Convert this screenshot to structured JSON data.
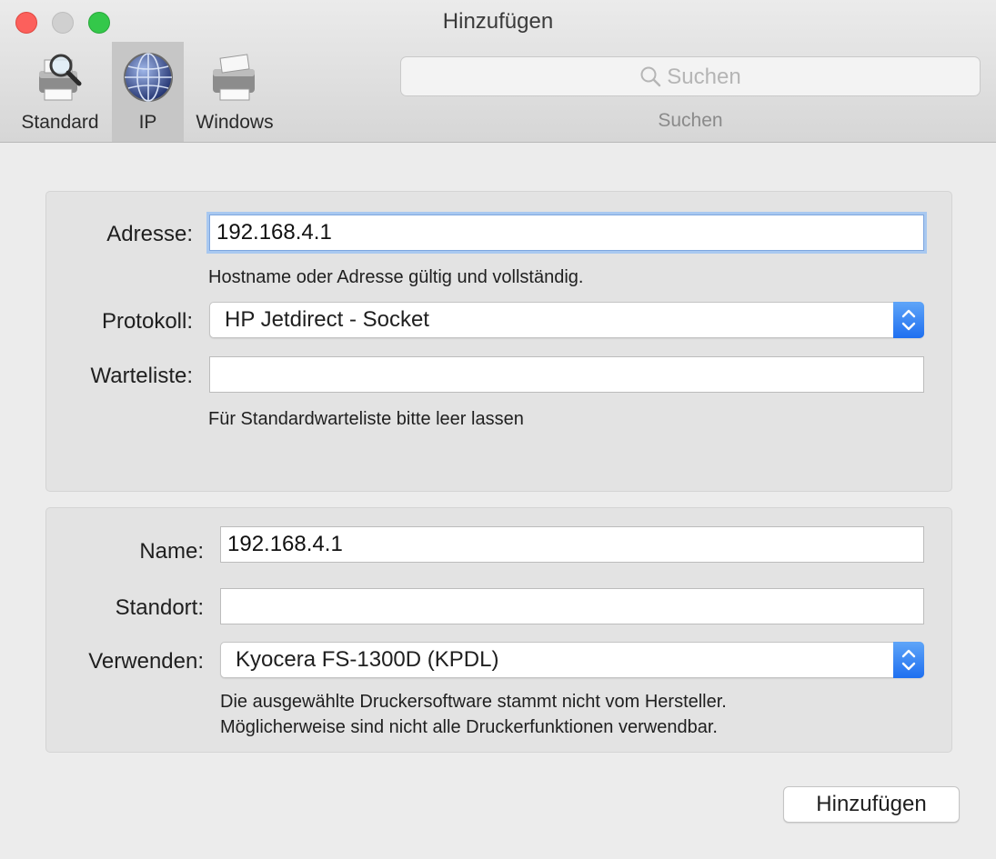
{
  "window": {
    "title": "Hinzufügen",
    "colors": {
      "close": "#fc605c",
      "minimize": "#d0d0d0",
      "maximize": "#34c84a",
      "accent": "#1e6ff0"
    }
  },
  "toolbar": {
    "items": [
      {
        "label": "Standard",
        "icon": "printer-search-icon",
        "selected": false
      },
      {
        "label": "IP",
        "icon": "network-globe-icon",
        "selected": true
      },
      {
        "label": "Windows",
        "icon": "printer-icon",
        "selected": false
      }
    ],
    "search": {
      "placeholder": "Suchen",
      "label": "Suchen",
      "icon": "search-icon"
    }
  },
  "ip_section": {
    "address": {
      "label": "Adresse:",
      "value": "192.168.4.1",
      "hint": "Hostname oder Adresse gültig und vollständig."
    },
    "protocol": {
      "label": "Protokoll:",
      "value": "HP Jetdirect - Socket"
    },
    "queue": {
      "label": "Warteliste:",
      "value": "",
      "hint": "Für Standardwarteliste bitte leer lassen"
    }
  },
  "printer_section": {
    "name": {
      "label": "Name:",
      "value": "192.168.4.1"
    },
    "location": {
      "label": "Standort:",
      "value": ""
    },
    "use": {
      "label": "Verwenden:",
      "value": "Kyocera FS-1300D (KPDL)",
      "hint_line1": "Die ausgewählte Druckersoftware stammt nicht vom Hersteller.",
      "hint_line2": "Möglicherweise sind nicht alle Druckerfunktionen verwendbar."
    }
  },
  "footer": {
    "add_button": "Hinzufügen"
  }
}
